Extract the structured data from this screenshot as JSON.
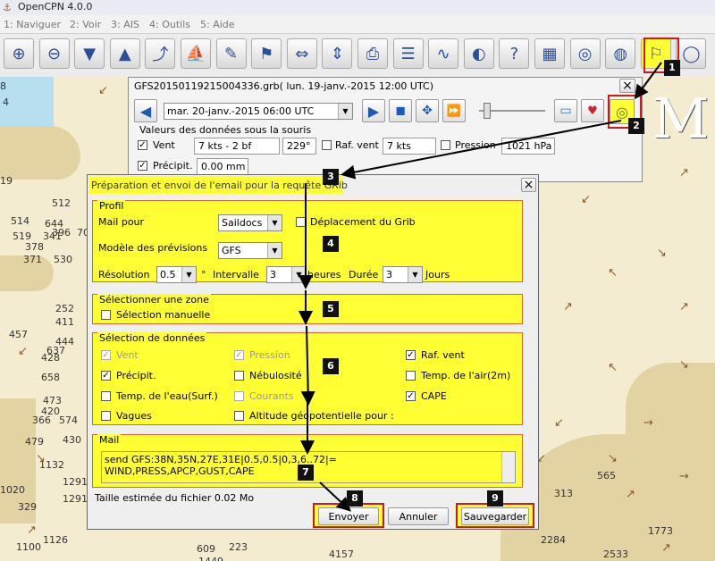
{
  "app": {
    "title": "OpenCPN 4.0.0"
  },
  "menu": [
    {
      "label": "1: Naviguer"
    },
    {
      "label": "2: Voir"
    },
    {
      "label": "3: AIS"
    },
    {
      "label": "4: Outils"
    },
    {
      "label": "5: Aide"
    }
  ],
  "toolbar": [
    {
      "icon": "zoom-in-icon",
      "glyph": "⊕"
    },
    {
      "icon": "zoom-out-icon",
      "glyph": "⊖"
    },
    {
      "icon": "scale-down-icon",
      "glyph": "▼"
    },
    {
      "icon": "scale-up-icon",
      "glyph": "▲"
    },
    {
      "icon": "route-icon",
      "glyph": "⤴"
    },
    {
      "icon": "ship-icon",
      "glyph": "⛵"
    },
    {
      "icon": "tools-icon",
      "glyph": "✎"
    },
    {
      "icon": "track-icon",
      "glyph": "⚑"
    },
    {
      "icon": "autofollow-icon",
      "glyph": "⇔"
    },
    {
      "icon": "tide-icon",
      "glyph": "⇕"
    },
    {
      "icon": "print-icon",
      "glyph": "⎙"
    },
    {
      "icon": "route-manager-icon",
      "glyph": "☰"
    },
    {
      "icon": "track-draw-icon",
      "glyph": "∿"
    },
    {
      "icon": "color-scheme-icon",
      "glyph": "◐"
    },
    {
      "icon": "help-icon",
      "glyph": "?"
    },
    {
      "icon": "chart-icon",
      "glyph": "▦"
    },
    {
      "icon": "dashboard-icon",
      "glyph": "◎"
    },
    {
      "icon": "weatherfax-icon",
      "glyph": "◍"
    },
    {
      "icon": "grib-icon",
      "glyph": "⚐"
    },
    {
      "icon": "mob-icon",
      "glyph": "◯"
    }
  ],
  "grib": {
    "title": "GFS20150119215004336.grb( lun. 19-janv.-2015 12:00  UTC)",
    "close": "×",
    "time": "mar. 20-janv.-2015 06:00  UTC",
    "cursor_title": "Valeurs des données sous la souris",
    "vent_label": "Vent",
    "vent_value": "7 kts -  2 bf",
    "vent_dir": "229°",
    "raf_label": "Raf. vent",
    "raf_value": "7 kts",
    "pression_label": "Pression",
    "pression_value": "1021 hPa",
    "precip_label": "Précipit.",
    "precip_value": "0.00 mm"
  },
  "email": {
    "title": "Préparation et envoi de l'email pour la requête GRib",
    "close": "×",
    "profil": {
      "group": "Profil",
      "mail_label": "Mail pour",
      "mail_value": "Saildocs",
      "deplacement": "Déplacement du Grib",
      "modele_label": "Modèle des prévisions",
      "modele_value": "GFS",
      "res_label": "Résolution",
      "res_value": "0.5",
      "deg": "°",
      "interval_label": "Intervalle",
      "interval_value": "3",
      "heures": "heures",
      "duree_label": "Durée",
      "duree_value": "3",
      "jours": "Jours"
    },
    "zone": {
      "group": "Sélectionner une zone",
      "manuelle": "Sélection manuelle"
    },
    "donnees": {
      "group": "Sélection de données",
      "vent": "Vent",
      "pression": "Pression",
      "raf": "Raf. vent",
      "precip": "Précipit.",
      "nebulosite": "Nébulosité",
      "temp_air": "Temp. de l'air(2m)",
      "temp_eau": "Temp. de l'eau(Surf.)",
      "courants": "Courants",
      "cape": "CAPE",
      "vagues": "Vagues",
      "altitude": "Altitude géopotentielle pour :"
    },
    "mail": {
      "group": "Mail",
      "line1": "send GFS:38N,35N,27E,31E|0.5,0.5|0,3,6..72|=",
      "line2": "WIND,PRESS,APCP,GUST,CAPE"
    },
    "taille": "Taille estimée du fichier 0.02 Mo",
    "envoyer": "Envoyer",
    "annuler": "Annuler",
    "sauvegarder": "Sauvegarder"
  },
  "badges": [
    "1",
    "2",
    "3",
    "4",
    "5",
    "6",
    "7",
    "8",
    "9"
  ],
  "chart": {
    "soundings": [
      "8",
      "4",
      "19",
      "514",
      "519",
      "341",
      "512",
      "644",
      "378",
      "396",
      "700",
      "371",
      "530",
      "252",
      "411",
      "444",
      "457",
      "637",
      "428",
      "658",
      "473",
      "420",
      "366",
      "574",
      "430",
      "479",
      "1132",
      "1020",
      "329",
      "1291",
      "1291",
      "1126",
      "1100",
      "609",
      "223",
      "1449",
      "4157",
      "2284",
      "1773",
      "313",
      "2533",
      "565"
    ],
    "coast_letter": "M"
  },
  "colors": {
    "highlight": "#ffff33",
    "red": "#cc1a1a"
  }
}
